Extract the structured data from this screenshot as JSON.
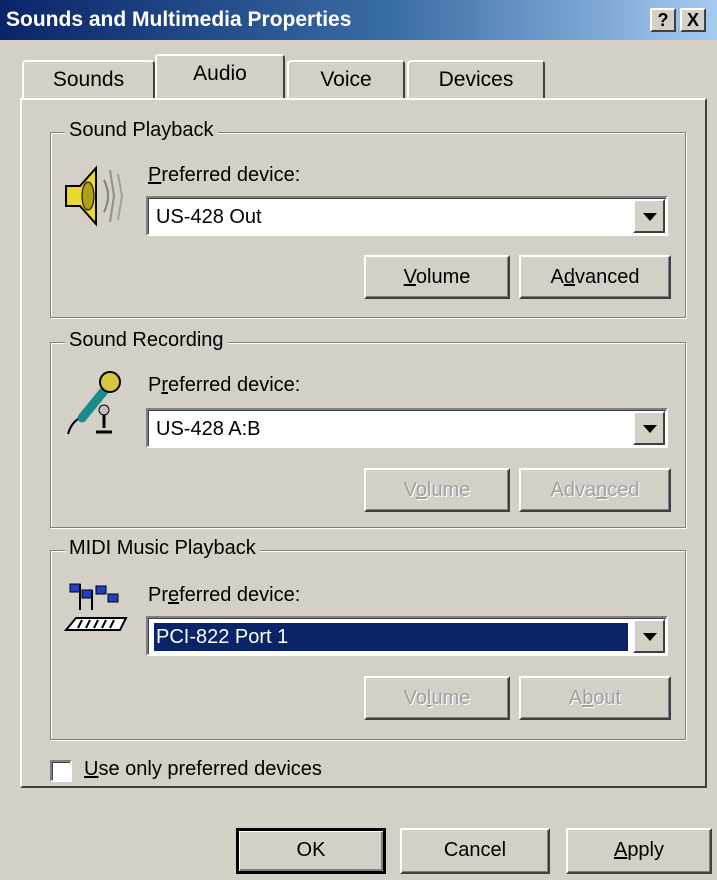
{
  "window": {
    "title": "Sounds and Multimedia Properties",
    "help_glyph": "?",
    "close_glyph": "X"
  },
  "tabs": [
    {
      "label": "Sounds"
    },
    {
      "label": "Audio"
    },
    {
      "label": "Voice"
    },
    {
      "label": "Devices"
    }
  ],
  "active_tab": "Audio",
  "playback": {
    "group_label": "Sound Playback",
    "pref_label_key": "P",
    "pref_label_rest": "referred device:",
    "device": "US-428 Out",
    "volume_key": "V",
    "volume_rest": "olume",
    "advanced_pre": "A",
    "advanced_key": "d",
    "advanced_post": "vanced"
  },
  "recording": {
    "group_label": "Sound Recording",
    "pref_label_pre": "P",
    "pref_label_key": "r",
    "pref_label_post": "eferred device:",
    "device": "US-428 A:B",
    "volume_pre": "V",
    "volume_key": "o",
    "volume_post": "lume",
    "advanced_pre": "Adva",
    "advanced_key": "n",
    "advanced_post": "ced"
  },
  "midi": {
    "group_label": "MIDI Music Playback",
    "pref_label_pre": "Pr",
    "pref_label_key": "e",
    "pref_label_post": "ferred device:",
    "device": "PCI-822 Port 1",
    "volume_pre": "Vo",
    "volume_key": "l",
    "volume_post": "ume",
    "about_pre": "A",
    "about_key": "b",
    "about_post": "out"
  },
  "checkbox": {
    "key": "U",
    "rest": "se only preferred devices",
    "checked": false
  },
  "footer": {
    "ok": "OK",
    "cancel": "Cancel",
    "apply_key": "A",
    "apply_rest": "pply"
  },
  "icons": {
    "playback": "speaker-icon",
    "recording": "microphone-icon",
    "midi": "midi-keyboard-icon"
  }
}
